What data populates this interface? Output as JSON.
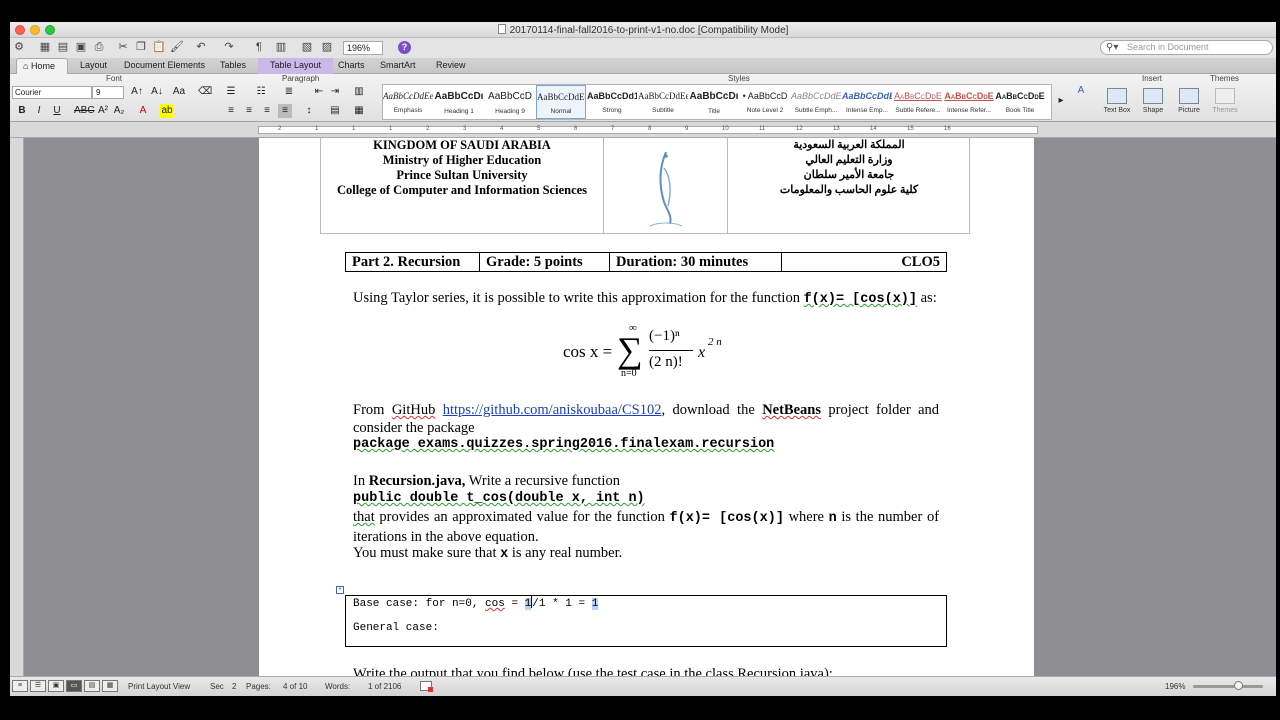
{
  "window": {
    "title": "20170114-final-fall2016-to-print-v1-no.doc [Compatibility Mode]"
  },
  "toolbar": {
    "zoom": "196%",
    "search_placeholder": "Search in Document"
  },
  "ribbon_tabs": [
    "Home",
    "Layout",
    "Document Elements",
    "Tables",
    "Table Layout",
    "Charts",
    "SmartArt",
    "Review"
  ],
  "ribbon": {
    "groups": {
      "font": "Font",
      "paragraph": "Paragraph",
      "styles": "Styles",
      "insert": "Insert",
      "themes": "Themes"
    },
    "font_name": "Courier",
    "font_size": "9",
    "styles": [
      {
        "sample": "AaBbCcDdEe",
        "name": "Emphasis"
      },
      {
        "sample": "AaBbCcDı",
        "name": "Heading 1"
      },
      {
        "sample": "AaBbCcD",
        "name": "Heading 9"
      },
      {
        "sample": "AaBbCcDdEe",
        "name": "Normal"
      },
      {
        "sample": "AaBbCcDd1",
        "name": "Strong"
      },
      {
        "sample": "AaBbCcDdEe",
        "name": "Subtitle"
      },
      {
        "sample": "AaBbCcDı",
        "name": "Title"
      },
      {
        "sample": "• AaBbCcD",
        "name": "Note Level 2"
      },
      {
        "sample": "AaBbCcDdEe",
        "name": "Subtle Emph..."
      },
      {
        "sample": "AaBbCcDdE",
        "name": "Intense Emp..."
      },
      {
        "sample": "AaBbCcDdE",
        "name": "Subtle Refere..."
      },
      {
        "sample": "AaBbCcDdE",
        "name": "Intense Refer..."
      },
      {
        "sample": "AaBbCcDdE",
        "name": "Book Title"
      }
    ],
    "insert_items": [
      "Text Box",
      "Shape",
      "Picture"
    ],
    "themes_label": "Themes"
  },
  "ruler_numbers": [
    "2",
    "1",
    "1",
    "1",
    "2",
    "3",
    "4",
    "5",
    "6",
    "7",
    "8",
    "9",
    "10",
    "11",
    "12",
    "13",
    "14",
    "15",
    "16"
  ],
  "document": {
    "header_left": [
      "KINGDOM OF SAUDI ARABIA",
      "Ministry of Higher Education",
      "Prince Sultan University",
      "College of Computer and Information Sciences"
    ],
    "header_right": [
      "المملكة العربية السعودية",
      "وزارة التعليم العالي",
      "جامعة الأمير سلطان",
      "كلية علوم الحاسب والمعلومات"
    ],
    "part_table": [
      "Part 2. Recursion",
      "Grade: 5 points",
      "Duration: 30 minutes",
      "CLO5"
    ],
    "para1_text": "Using Taylor series, it is possible to write this approximation for the function",
    "func_code": "f(x)= [cos(x)]",
    "para1_end": " as:",
    "formula": {
      "lhs": "cos x =",
      "sum_top": "∞",
      "sum_bottom": "n=0",
      "numerator": "(−1)ⁿ",
      "denominator": "(2 n)!",
      "var": "x",
      "exp": "2 n"
    },
    "from_text": "From ",
    "github_text": "GitHub",
    "github_url": "https://github.com/aniskoubaa/CS102",
    "download_text": ", download the ",
    "netbeans_text": "NetBeans",
    "project_text": " project folder and consider the package",
    "package_line": "package exams.quizzes.spring2016.finalexam.recursion",
    "in_text": "In ",
    "recursion_file": "Recursion.java,",
    "write_text": " Write a recursive function",
    "signature": "public double t_cos(double x, int n)",
    "that_text": "that",
    "provides_text": " provides an approximated value for the function ",
    "where_text": " where ",
    "n_code": "n",
    "iterations_text": " is the number of iterations in the above equation.",
    "make_sure_text": "You must make sure that ",
    "x_code": "x",
    "real_text": " is any real number.",
    "base_case_prefix": "Base case: for n=0, ",
    "base_case_cos": "cos",
    "base_case_eq": " = ",
    "base_case_one": "1",
    "base_case_rest": "/1 * 1 = ",
    "base_case_result": "1",
    "general_case": "General case:",
    "cutoff_text": "Write the output that you find below (use the test case in the class Recursion.java):"
  },
  "statusbar": {
    "view_label": "Print Layout View",
    "sec_label": "Sec",
    "sec_value": "2",
    "pages_label": "Pages:",
    "pages_value": "4 of 10",
    "words_label": "Words:",
    "words_value": "1 of 2106",
    "zoom": "196%"
  }
}
